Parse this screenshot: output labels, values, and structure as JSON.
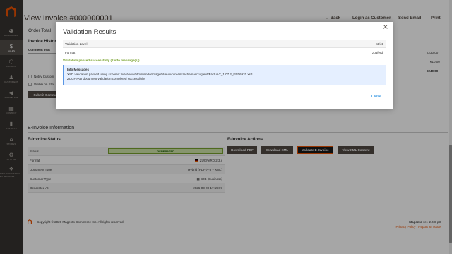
{
  "sidebar": {
    "items": [
      {
        "glyph": "◕",
        "label": "Dashboard",
        "icon": "dashboard-icon"
      },
      {
        "glyph": "$",
        "label": "Sales",
        "icon": "sales-icon",
        "active": true
      },
      {
        "glyph": "⬡",
        "label": "Catalog",
        "icon": "catalog-icon"
      },
      {
        "glyph": "♟",
        "label": "Customers",
        "icon": "customers-icon"
      },
      {
        "glyph": "◀",
        "label": "Marketing",
        "icon": "marketing-icon"
      },
      {
        "glyph": "▦",
        "label": "Content",
        "icon": "content-icon"
      },
      {
        "glyph": "▮",
        "label": "Reports",
        "icon": "reports-icon"
      },
      {
        "glyph": "⌂",
        "label": "Stores",
        "icon": "stores-icon"
      },
      {
        "glyph": "⚙",
        "label": "System",
        "icon": "system-icon"
      },
      {
        "glyph": "❖",
        "label": "Find Partners & Extensions",
        "icon": "extensions-icon"
      }
    ]
  },
  "header": {
    "title": "View Invoice #000000001",
    "back": "← Back",
    "login_as_customer": "Login as Customer",
    "send_email": "Send Email",
    "print": "Print"
  },
  "background": {
    "order_total": "Order Total",
    "invoice_history": "Invoice Histor",
    "comment_text": "Comment Text",
    "notify_customer": "Notify Custom",
    "visible_on_storefront": "Visible on Stor",
    "submit_comment": "Submit Comme",
    "totals": [
      "€230.00",
      "€10.00",
      "€240.00"
    ]
  },
  "modal": {
    "title": "Validation Results",
    "close_icon": "×",
    "rows": [
      {
        "key": "Validation Level",
        "value": "strict"
      },
      {
        "key": "Format",
        "value": "zugferd"
      }
    ],
    "success": "Validation passed successfully (2 info message(s))",
    "info_title": "Info Messages",
    "info_lines": [
      "XSD validation passed using schema: /var/www/html/vendor/magebit/e-invoice/etc/schemas/zugferd/Factur-X_1.07.2_EN16931.xsd",
      "ZUGFeRD document validation completed successfully"
    ],
    "close_label": "Close"
  },
  "einvoice": {
    "section_title": "E-Invoice Information",
    "status_title": "E-Invoice Status",
    "actions_title": "E-Invoice Actions",
    "rows": [
      {
        "key": "Status",
        "value": "GENERATED"
      },
      {
        "key": "Format",
        "value": "ZUGFeRD 2.3.x"
      },
      {
        "key": "Document Type",
        "value": "Hybrid (PDF/A-3 + XML)"
      },
      {
        "key": "Customer Type",
        "value": "B2B (Business)"
      },
      {
        "key": "Generated At",
        "value": "2026-03-09 17:15:07"
      }
    ],
    "actions": [
      "Download PDF",
      "Download XML",
      "Validate E-Invoice",
      "View XML Content"
    ]
  },
  "footer": {
    "copyright": "Copyright © 2026 Magento Commerce Inc. All rights reserved.",
    "version_brand": "Magento",
    "version": "ver. 2.4.8-p3",
    "privacy": "Privacy Policy",
    "separator": "|",
    "report": "Report an Issue"
  }
}
